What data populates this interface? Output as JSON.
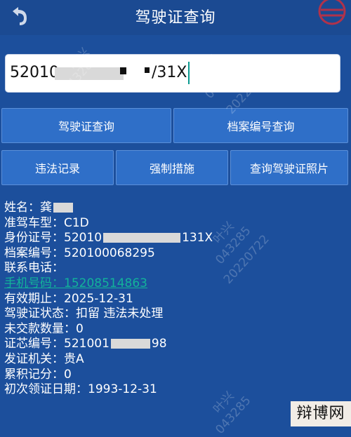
{
  "header": {
    "title": "驾驶证查询",
    "back_icon": "back-arrow-icon",
    "right_icon": "globe-icon"
  },
  "search": {
    "value_prefix": "52010",
    "value_suffix": "/31X"
  },
  "buttons": {
    "row1": [
      "驾驶证查询",
      "档案编号查询"
    ],
    "row2": [
      "违法记录",
      "强制措施",
      "查询驾驶证照片"
    ]
  },
  "info": [
    {
      "k": "姓名：",
      "v": "龚"
    },
    {
      "k": "准驾车型：",
      "v": "C1D"
    },
    {
      "k": "身份证号：",
      "v": "52010",
      "v2": "131X"
    },
    {
      "k": "档案编号：",
      "v": "520100068295"
    },
    {
      "k": "联系电话：",
      "v": ""
    },
    {
      "k": "手机号码：",
      "v": "15208514863",
      "link": true
    },
    {
      "k": "有效期止：",
      "v": "2025-12-31"
    },
    {
      "k": "驾驶证状态：",
      "v": "扣留 违法未处理"
    },
    {
      "k": "未交款数量：",
      "v": "0"
    },
    {
      "k": "证芯编号：",
      "v": "521001",
      "v2": "98"
    },
    {
      "k": "发证机关：",
      "v": "贵A"
    },
    {
      "k": "累积记分：",
      "v": "0"
    },
    {
      "k": "初次领证日期：",
      "v": "1993-12-31"
    }
  ],
  "watermark": [
    "叶兴",
    "043285",
    "20220722"
  ],
  "corner_logo": "辩博网"
}
